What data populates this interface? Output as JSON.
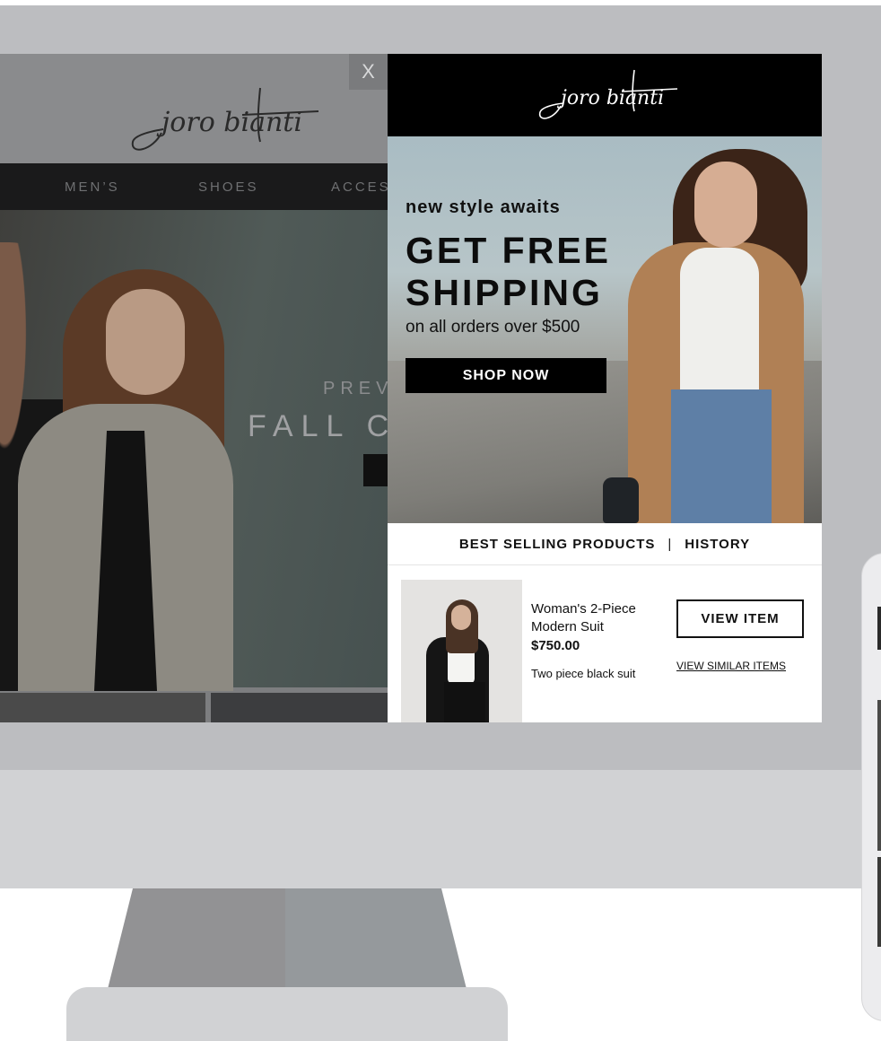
{
  "site": {
    "logo_text": "joro bianti",
    "nav": [
      "MEN’S",
      "SHOES",
      "ACCESS"
    ],
    "hero_line1": "PREV",
    "hero_line2": "FALL C"
  },
  "close_label": "X",
  "popup": {
    "logo_text": "joro bianti",
    "tagline": "new style awaits",
    "headline": "GET FREE\nSHIPPING",
    "subline": "on all orders over $500",
    "cta": "SHOP NOW",
    "tabs": [
      "BEST SELLING PRODUCTS",
      "HISTORY"
    ],
    "tab_separator": "|",
    "product": {
      "name": "Woman's 2-Piece Modern Suit",
      "price": "$750.00",
      "description": "Two piece black suit",
      "view_label": "VIEW ITEM",
      "similar_label": "VIEW SIMILAR ITEMS"
    }
  },
  "colors": {
    "popup_header": "#000000",
    "cta_background": "#000000",
    "bezel": "#bcbdc0"
  }
}
